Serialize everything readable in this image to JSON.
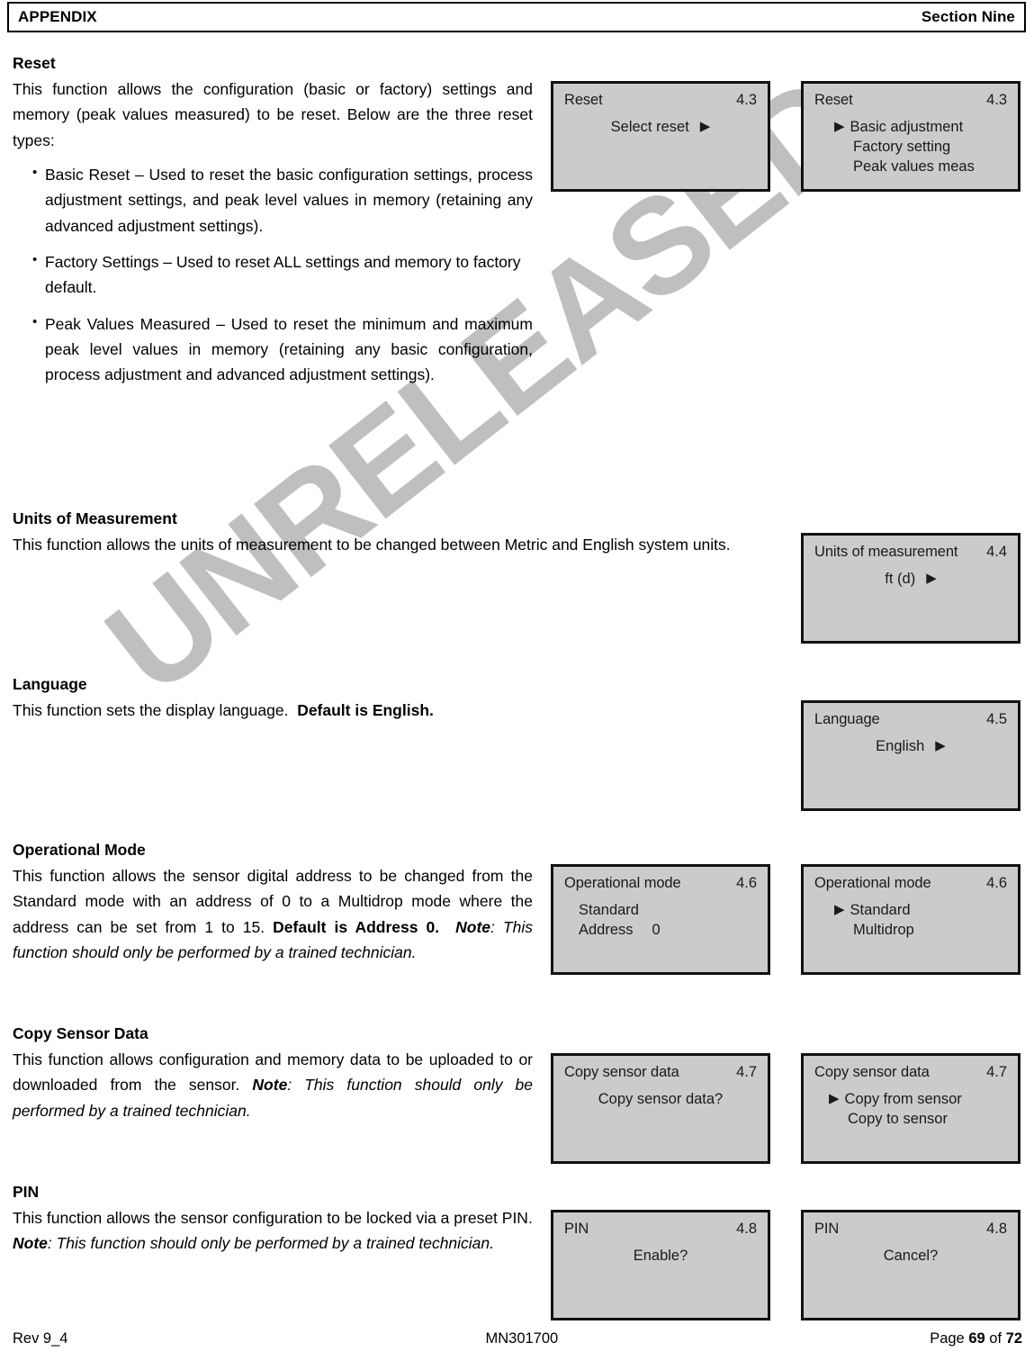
{
  "header": {
    "left": "APPENDIX",
    "right": "Section Nine"
  },
  "watermark": {
    "text": "UNRELEASED"
  },
  "sections": {
    "reset": {
      "heading": "Reset",
      "intro": "This function allows the configuration (basic or factory) settings and memory (peak values measured) to be reset. Below are the three reset types:",
      "bullets": [
        "Basic Reset – Used to reset the basic configuration settings, process adjustment settings, and peak level values in memory (retaining any advanced adjustment settings).",
        "Factory Settings – Used to reset ALL settings and memory to factory default.",
        "Peak Values Measured – Used to reset the minimum and maximum peak level values in memory (retaining any basic configuration, process adjustment and advanced adjustment settings)."
      ]
    },
    "units": {
      "heading": "Units of Measurement",
      "body": "This function allows the units of measurement to be changed between Metric and English system units."
    },
    "language": {
      "heading": "Language",
      "body_plain": "This function sets the display language.",
      "body_bold": "Default is English."
    },
    "operational_mode": {
      "heading": "Operational Mode",
      "body_plain": "This function allows the sensor digital address to be changed from the Standard mode with an address of 0 to a Multidrop mode where the address can be set from 1 to 15.",
      "body_bold": "Default is Address 0.",
      "note_label": "Note",
      "note_text": ": This function should only be performed by a trained technician."
    },
    "copy_sensor_data": {
      "heading": "Copy Sensor Data",
      "body_plain": "This function allows configuration and memory data to be uploaded to or downloaded from the sensor.",
      "note_label": "Note",
      "note_text": ": This function should only be performed by a trained technician."
    },
    "pin": {
      "heading": "PIN",
      "body_plain": "This function allows the sensor configuration to be locked via a preset PIN.",
      "note_label": "Note",
      "note_text": ": This function should only be performed by a trained technician."
    }
  },
  "lcd_panels": {
    "reset_prompt": {
      "title": "Reset",
      "number": "4.3",
      "line1": "Select reset",
      "arrow": "▶"
    },
    "reset_menu": {
      "title": "Reset",
      "number": "4.3",
      "arrow": "▶",
      "item1": "Basic adjustment",
      "item2": "Factory setting",
      "item3": "Peak values meas"
    },
    "units": {
      "title": "Units of measurement",
      "number": "4.4",
      "value": "ft (d)",
      "arrow": "▶"
    },
    "language": {
      "title": "Language",
      "number": "4.5",
      "value": "English",
      "arrow": "▶"
    },
    "opmode_status": {
      "title": "Operational mode",
      "number": "4.6",
      "line1": "Standard",
      "line2_label": "Address",
      "line2_value": "0"
    },
    "opmode_menu": {
      "title": "Operational mode",
      "number": "4.6",
      "arrow": "▶",
      "item1": "Standard",
      "item2": "Multidrop"
    },
    "copy_prompt": {
      "title": "Copy sensor data",
      "number": "4.7",
      "line1": "Copy sensor data?"
    },
    "copy_menu": {
      "title": "Copy sensor data",
      "number": "4.7",
      "arrow": "▶",
      "item1": "Copy from sensor",
      "item2": "Copy to sensor"
    },
    "pin_enable": {
      "title": "PIN",
      "number": "4.8",
      "line1": "Enable?"
    },
    "pin_cancel": {
      "title": "PIN",
      "number": "4.8",
      "line1": "Cancel?"
    }
  },
  "footer": {
    "left": "Rev 9_4",
    "center": "MN301700",
    "page_word": "Page",
    "page_number": "69",
    "of_word": "of",
    "total_pages": "72"
  }
}
